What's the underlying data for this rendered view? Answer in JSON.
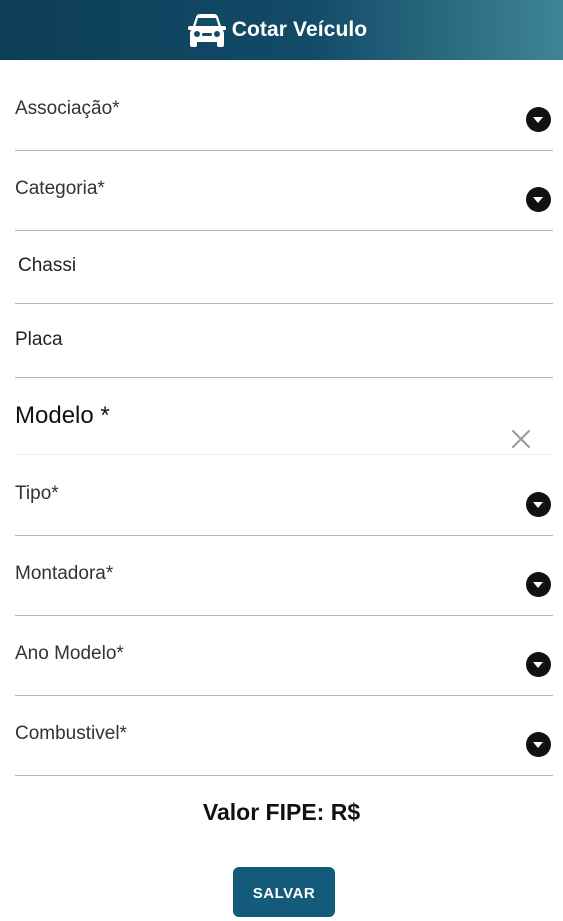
{
  "header": {
    "title": "Cotar Veículo",
    "icon": "car-icon",
    "background_start": "#0d3d57",
    "background_end": "#3f8496"
  },
  "form": {
    "associacao": {
      "label": "Associação*"
    },
    "categoria": {
      "label": "Categoria*"
    },
    "chassi": {
      "placeholder": "Chassi",
      "value": ""
    },
    "placa": {
      "placeholder": "Placa",
      "value": ""
    },
    "modelo": {
      "placeholder": "Modelo *",
      "value": ""
    },
    "tipo": {
      "label": "Tipo*"
    },
    "montadora": {
      "label": "Montadora*"
    },
    "ano_modelo": {
      "label": "Ano Modelo*"
    },
    "combustivel": {
      "label": "Combustivel*"
    }
  },
  "fipe": {
    "label": "Valor FIPE: R$"
  },
  "actions": {
    "save_label": "SALVAR",
    "save_color": "#145a7a"
  }
}
